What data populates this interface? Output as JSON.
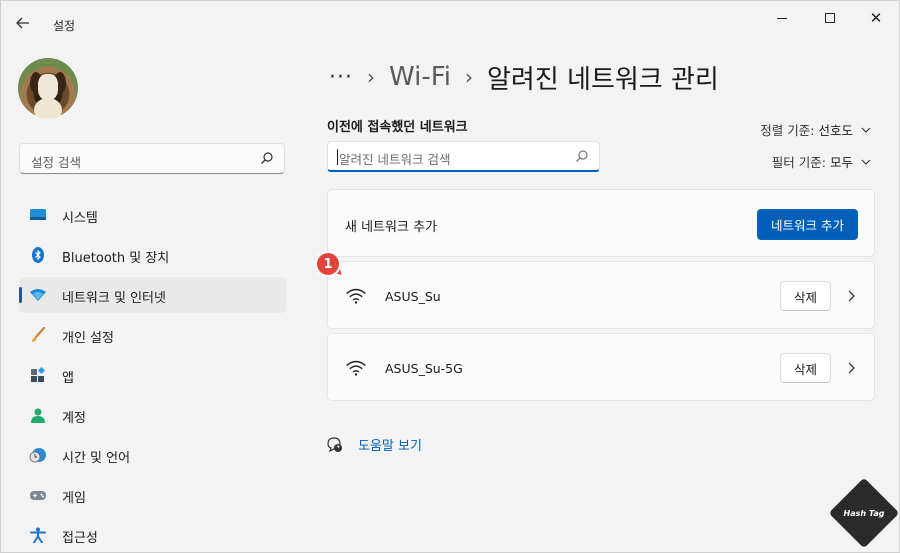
{
  "window": {
    "title": "설정",
    "back_icon": "arrow-left-icon"
  },
  "sidebar": {
    "search_placeholder": "설정 검색",
    "items": [
      {
        "label": "시스템",
        "icon": "system-icon"
      },
      {
        "label": "Bluetooth 및 장치",
        "icon": "bluetooth-icon"
      },
      {
        "label": "네트워크 및 인터넷",
        "icon": "network-icon",
        "active": true
      },
      {
        "label": "개인 설정",
        "icon": "brush-icon"
      },
      {
        "label": "앱",
        "icon": "apps-icon"
      },
      {
        "label": "계정",
        "icon": "account-icon"
      },
      {
        "label": "시간 및 언어",
        "icon": "time-language-icon"
      },
      {
        "label": "게임",
        "icon": "gamepad-icon"
      },
      {
        "label": "접근성",
        "icon": "accessibility-icon"
      }
    ]
  },
  "breadcrumb": {
    "dots": "···",
    "parent": "Wi-Fi",
    "current": "알려진 네트워크 관리"
  },
  "main": {
    "section_title": "이전에 접속했던 네트워크",
    "search_placeholder": "알려진 네트워크 검색",
    "sort": {
      "label": "정렬 기준:",
      "value": "선호도"
    },
    "filter": {
      "label": "필터 기준:",
      "value": "모두"
    },
    "add_network": {
      "label": "새 네트워크 추가",
      "button": "네트워크 추가"
    },
    "networks": [
      {
        "name": "ASUS_Su",
        "delete": "삭제"
      },
      {
        "name": "ASUS_Su-5G",
        "delete": "삭제"
      }
    ],
    "help": "도움말 보기"
  },
  "annotation": {
    "badge": "1"
  },
  "watermark": {
    "text": "Hash Tag"
  },
  "colors": {
    "accent": "#005fb8",
    "badge": "#e0443b",
    "background": "#f3f3f3",
    "card": "#fbfbfb"
  }
}
